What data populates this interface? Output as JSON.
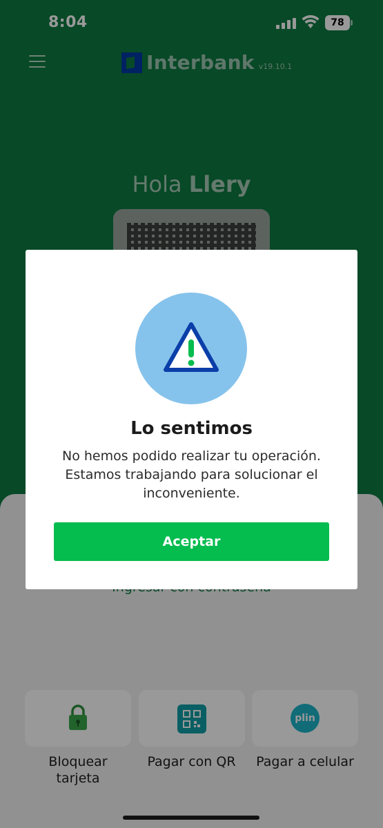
{
  "status_bar": {
    "time": "8:04",
    "battery": "78"
  },
  "header": {
    "brand_name": "Interbank",
    "version": "v19.10.1"
  },
  "greeting": {
    "prefix": "Hola",
    "name": "Llery"
  },
  "login": {
    "password_link": "Ingresar con contraseña"
  },
  "quick_actions": [
    {
      "label": "Bloquear tarjeta",
      "icon": "lock-icon"
    },
    {
      "label": "Pagar con QR",
      "icon": "qr-code-icon"
    },
    {
      "label": "Pagar a celular",
      "icon": "plin-icon"
    }
  ],
  "plin_logo_text": "plin",
  "dialog": {
    "icon": "warning-icon",
    "title": "Lo sentimos",
    "message": "No hemos podido realizar tu operación. Estamos trabajando para solucionar el inconveniente.",
    "button_label": "Aceptar"
  },
  "colors": {
    "brand_green": "#0e7a41",
    "button_green": "#05bc4f",
    "alert_circle": "#86c3ec",
    "warning_stroke": "#0b3ea8",
    "warning_mark": "#05bc4f"
  }
}
